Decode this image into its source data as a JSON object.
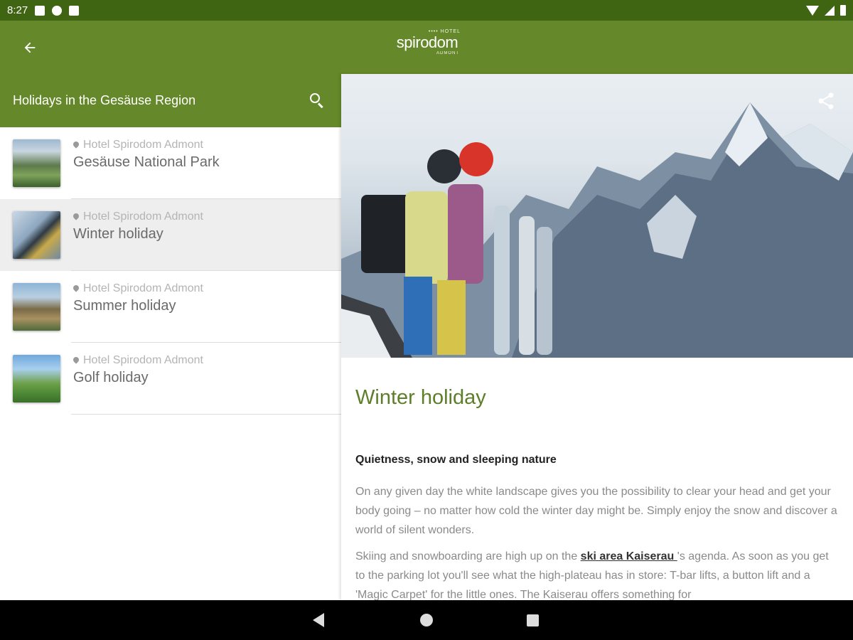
{
  "status_bar": {
    "time": "8:27",
    "icons": [
      "notification-icon",
      "app-icon-f",
      "sd-card-icon",
      "wifi-icon",
      "signal-icon",
      "battery-icon"
    ]
  },
  "app_bar": {
    "back_icon": "arrow-back-icon",
    "logo": {
      "top": "•••• HOTEL",
      "main": "spirodom",
      "bottom": "ADMONT"
    },
    "color": "#65882a"
  },
  "left_pane": {
    "header_title": "Holidays in the Gesäuse Region",
    "search_icon": "search-icon",
    "items": [
      {
        "location": "Hotel Spirodom Admont",
        "title": "Gesäuse National Park",
        "selected": false
      },
      {
        "location": "Hotel Spirodom Admont",
        "title": "Winter holiday",
        "selected": true
      },
      {
        "location": "Hotel Spirodom Admont",
        "title": "Summer holiday",
        "selected": false
      },
      {
        "location": "Hotel Spirodom Admont",
        "title": "Golf holiday",
        "selected": false
      }
    ]
  },
  "detail": {
    "share_icon": "share-icon",
    "title": "Winter holiday",
    "subtitle": "Quietness, snow and sleeping nature",
    "paragraph1": "On any given day the white landscape gives you the possibility to clear your head and get your body going – no matter how cold the winter day might be. Simply enjoy the snow and discover a world of silent wonders.",
    "paragraph2_before": "Skiing and snowboarding are high up on the ",
    "paragraph2_link": "ski area Kaiserau ",
    "paragraph2_after": "'s agenda. As soon as you get to the parking lot you'll see what the high-plateau has in store: T-bar lifts, a button lift and a 'Magic Carpet' for the little ones. The Kaiserau offers something for",
    "title_color": "#5e7f2a"
  },
  "nav_bar": {
    "icons": [
      "nav-back-icon",
      "nav-home-icon",
      "nav-recents-icon"
    ]
  }
}
